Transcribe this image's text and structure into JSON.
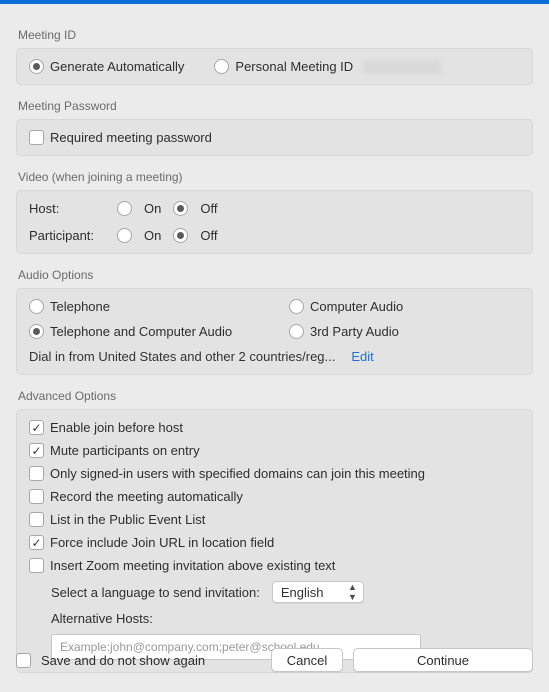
{
  "sections": {
    "meeting_id": {
      "label": "Meeting ID"
    },
    "meeting_password": {
      "label": "Meeting Password"
    },
    "video": {
      "label": "Video (when joining a meeting)"
    },
    "audio": {
      "label": "Audio Options"
    },
    "advanced": {
      "label": "Advanced Options"
    }
  },
  "meeting_id": {
    "generate_auto": "Generate Automatically",
    "personal": "Personal Meeting ID"
  },
  "password": {
    "required": "Required meeting password"
  },
  "video": {
    "host_label": "Host:",
    "participant_label": "Participant:",
    "on": "On",
    "off": "Off"
  },
  "audio": {
    "telephone": "Telephone",
    "computer_audio": "Computer Audio",
    "tel_and_computer": "Telephone and Computer Audio",
    "third_party": "3rd Party Audio",
    "dialin": "Dial in from United States and other 2 countries/reg...",
    "edit": "Edit"
  },
  "advanced": {
    "enable_join_before_host": "Enable join before host",
    "mute_on_entry": "Mute participants on entry",
    "signed_in_domains": "Only signed-in users with specified domains can join this meeting",
    "record_auto": "Record the meeting automatically",
    "list_public": "List in the Public Event List",
    "force_join_url": "Force include Join URL in location field",
    "insert_invitation": "Insert Zoom meeting invitation above existing text",
    "lang_label": "Select a language to send invitation:",
    "lang_value": "English",
    "alt_hosts_label": "Alternative Hosts:",
    "alt_hosts_placeholder": "Example:john@company.com;peter@school.edu"
  },
  "footer": {
    "save_no_show": "Save and do not show again",
    "cancel": "Cancel",
    "continue": "Continue"
  }
}
